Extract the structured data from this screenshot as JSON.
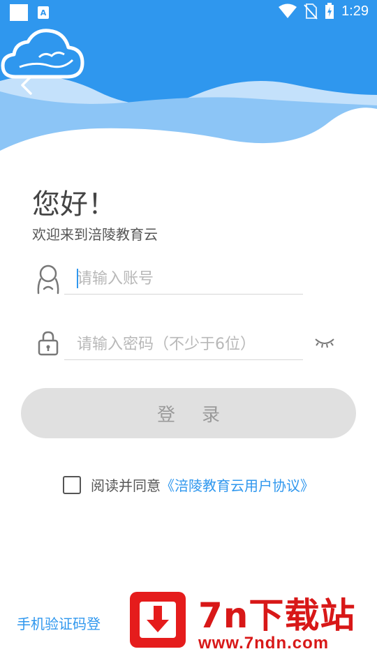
{
  "status_bar": {
    "time": "1:29",
    "icons": [
      "notification-square-icon",
      "a-app-icon",
      "wifi-icon",
      "no-sim-icon",
      "battery-charging-icon"
    ]
  },
  "header": {
    "back_icon": "chevron-left-icon",
    "logo_icon": "cloud-logo-icon",
    "colors": {
      "top": "#2f97ee",
      "wave": "#8cc5f6",
      "wave_light": "#c4e1fb"
    }
  },
  "greeting": {
    "title": "您好！",
    "subtitle": "欢迎来到涪陵教育云"
  },
  "form": {
    "account": {
      "placeholder": "请输入账号",
      "value": "",
      "icon": "user-icon"
    },
    "password": {
      "placeholder": "请输入密码（不少于6位）",
      "value": "",
      "icon": "lock-icon",
      "toggle_icon": "eye-closed-icon"
    },
    "login_label": "登录"
  },
  "agreement": {
    "checked": false,
    "text": "阅读并同意",
    "link": "《涪陵教育云用户协议》"
  },
  "footer": {
    "sms_login": "手机验证码登"
  },
  "watermark": {
    "title": "7n下载站",
    "url": "www.7ndn.com",
    "icon": "download-arrow-icon"
  }
}
